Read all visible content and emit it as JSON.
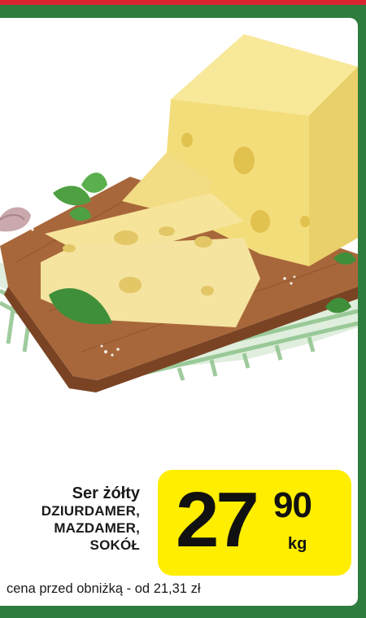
{
  "product": {
    "name_line1": "Ser żółty",
    "name_line2": "DZIURDAMER,",
    "name_line3": "MAZDAMER,",
    "name_line4": "SOKÓŁ"
  },
  "price": {
    "integer": "27",
    "decimal": "90",
    "unit": "kg"
  },
  "previous_price_note": "cena przed obniżką - od 21,31 zł",
  "image": {
    "subject": "cheese-icon"
  },
  "colors": {
    "border_green": "#2e7d3e",
    "price_yellow": "#ffee00",
    "top_red": "#d9232e"
  }
}
